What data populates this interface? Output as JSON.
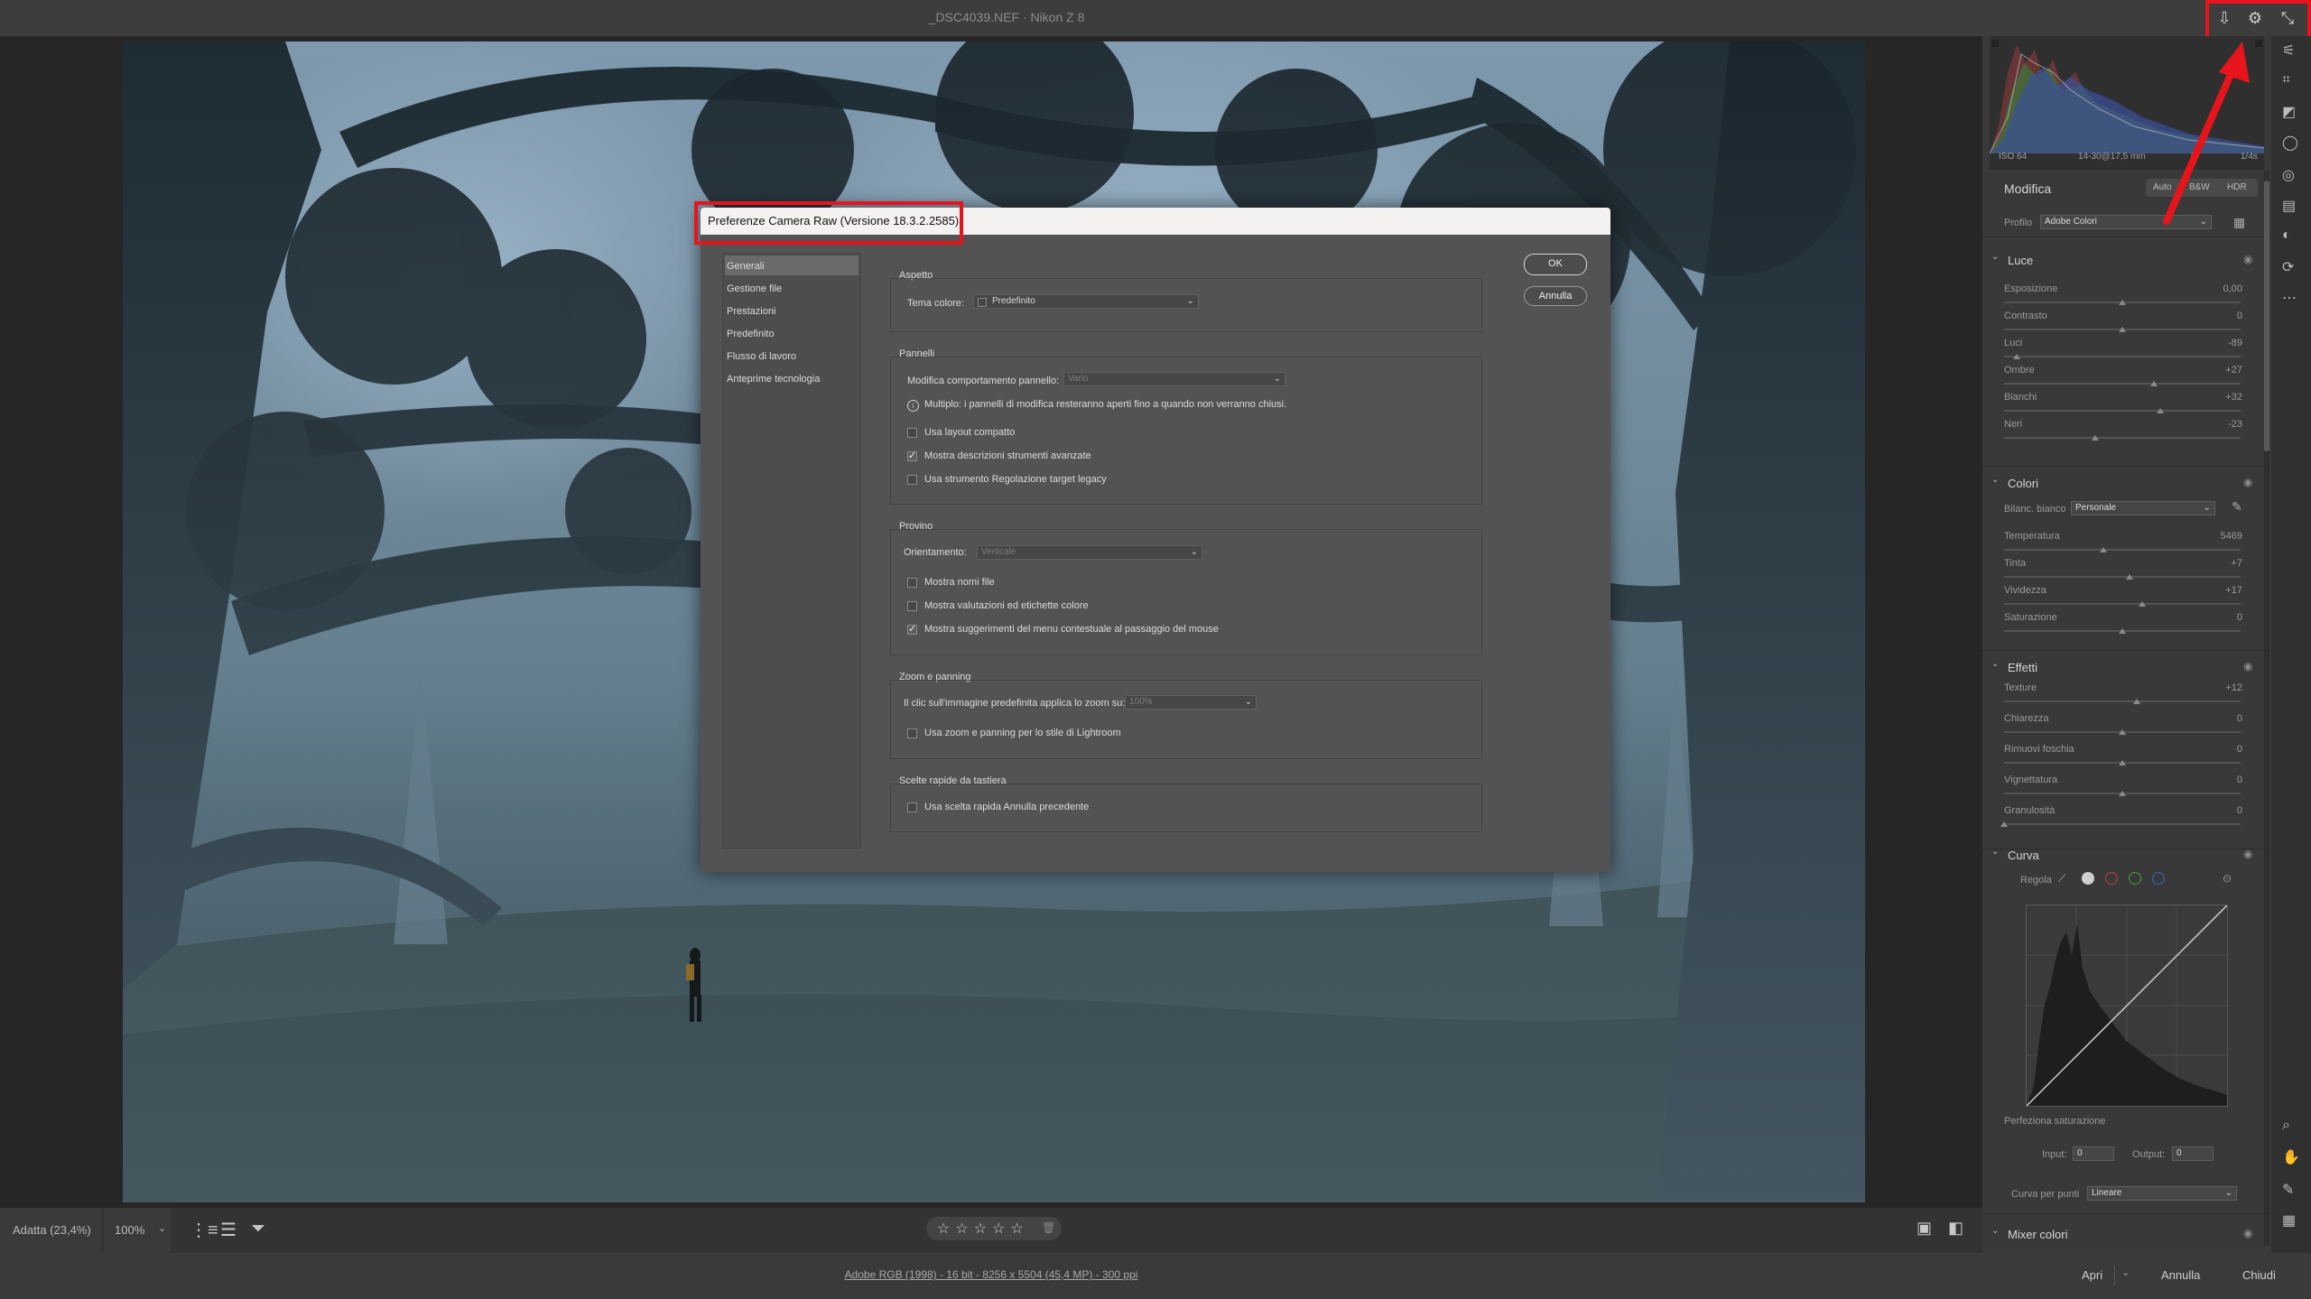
{
  "window": {
    "title": "_DSC4039.NEF  ·  Nikon Z 8"
  },
  "titlebar_icons": [
    "export-icon",
    "gear-icon",
    "collapse-icon"
  ],
  "bottombar": {
    "zoom_fit": "Adatta (23,4%)",
    "zoom_100": "100%",
    "stars": [
      "☆",
      "☆",
      "☆",
      "☆",
      "☆"
    ],
    "trash": "🗑"
  },
  "statusbar": {
    "info": "Adobe RGB (1998) - 16 bit - 8256 x 5504 (45,4 MP) - 300 ppi",
    "open_label": "Apri",
    "cancel_label": "Annulla",
    "close_label": "Chiudi"
  },
  "histogram": {
    "iso": "ISO 64",
    "lens": "14-30@17,5 mm",
    "aperture": "f/",
    "shutter": "1/4s"
  },
  "edit": {
    "title": "Modifica",
    "auto_label": "Auto",
    "bw_label": "B&W",
    "hdr_label": "HDR",
    "profile_label": "Profilo",
    "profile_value": "Adobe Colori"
  },
  "sections": {
    "light": {
      "title": "Luce",
      "sliders": [
        {
          "label": "Esposizione",
          "value": "0,00",
          "pos": 0.5
        },
        {
          "label": "Contrasto",
          "value": "0",
          "pos": 0.5
        },
        {
          "label": "Luci",
          "value": "-89",
          "pos": 0.055
        },
        {
          "label": "Ombre",
          "value": "+27",
          "pos": 0.635
        },
        {
          "label": "Bianchi",
          "value": "+32",
          "pos": 0.66
        },
        {
          "label": "Neri",
          "value": "-23",
          "pos": 0.385
        }
      ]
    },
    "color": {
      "title": "Colori",
      "wb_label": "Bilanc. bianco",
      "wb_value": "Personale",
      "sliders": [
        {
          "label": "Temperatura",
          "value": "5469",
          "pos": 0.42
        },
        {
          "label": "Tinta",
          "value": "+7",
          "pos": 0.53
        },
        {
          "label": "Vividezza",
          "value": "+17",
          "pos": 0.585
        },
        {
          "label": "Saturazione",
          "value": "0",
          "pos": 0.5
        }
      ]
    },
    "effects": {
      "title": "Effetti",
      "sliders": [
        {
          "label": "Texture",
          "value": "+12",
          "pos": 0.56
        },
        {
          "label": "Chiarezza",
          "value": "0",
          "pos": 0.5
        },
        {
          "label": "Rimuovi foschia",
          "value": "0",
          "pos": 0.5
        },
        {
          "label": "Vignettatura",
          "value": "0",
          "pos": 0.5
        },
        {
          "label": "Granulosità",
          "value": "0",
          "pos": 0.0
        }
      ]
    },
    "curve": {
      "title": "Curva",
      "regola_label": "Regola",
      "refine_label": "Perfeziona saturazione",
      "input_label": "Input:",
      "input_value": "0",
      "output_label": "Output:",
      "output_value": "0",
      "point_curve_label": "Curva per punti",
      "point_curve_value": "Lineare"
    },
    "mixer": {
      "title": "Mixer colori"
    }
  },
  "dialog": {
    "title": "Preferenze Camera Raw  (Versione 18.3.2.2585)",
    "nav": [
      "Generali",
      "Gestione file",
      "Prestazioni",
      "Predefinito",
      "Flusso di lavoro",
      "Anteprime tecnologia"
    ],
    "ok_label": "OK",
    "cancel_label": "Annulla",
    "aspetto": {
      "title": "Aspetto",
      "theme_label": "Tema colore:",
      "theme_value": "Predefinito"
    },
    "pannelli": {
      "title": "Pannelli",
      "behavior_label": "Modifica comportamento pannello:",
      "behavior_value": "Vario",
      "info_text": "Multiplo: i pannelli di modifica resteranno aperti fino a quando non verranno chiusi.",
      "options": [
        {
          "label": "Usa layout compatto",
          "checked": false
        },
        {
          "label": "Mostra descrizioni strumenti avanzate",
          "checked": true
        },
        {
          "label": "Usa strumento Regolazione target legacy",
          "checked": false
        }
      ]
    },
    "provino": {
      "title": "Provino",
      "orient_label": "Orientamento:",
      "orient_value": "Verticale",
      "options": [
        {
          "label": "Mostra nomi file",
          "checked": false
        },
        {
          "label": "Mostra valutazioni ed etichette colore",
          "checked": false
        },
        {
          "label": "Mostra suggerimenti del menu contestuale al passaggio del mouse",
          "checked": true
        }
      ]
    },
    "zoom": {
      "title": "Zoom e panning",
      "click_label": "Il clic sull'immagine predefinita applica lo zoom su:",
      "click_value": "100%",
      "options": [
        {
          "label": "Usa zoom e panning per lo stile di Lightroom",
          "checked": false
        }
      ]
    },
    "shortcuts": {
      "title": "Scelte rapide da tastiera",
      "options": [
        {
          "label": "Usa scelta rapida Annulla precedente",
          "checked": false
        }
      ]
    }
  },
  "colors": {
    "highlight": "#e8141b",
    "dialog_bg": "#535353",
    "panel_bg": "#393939"
  }
}
